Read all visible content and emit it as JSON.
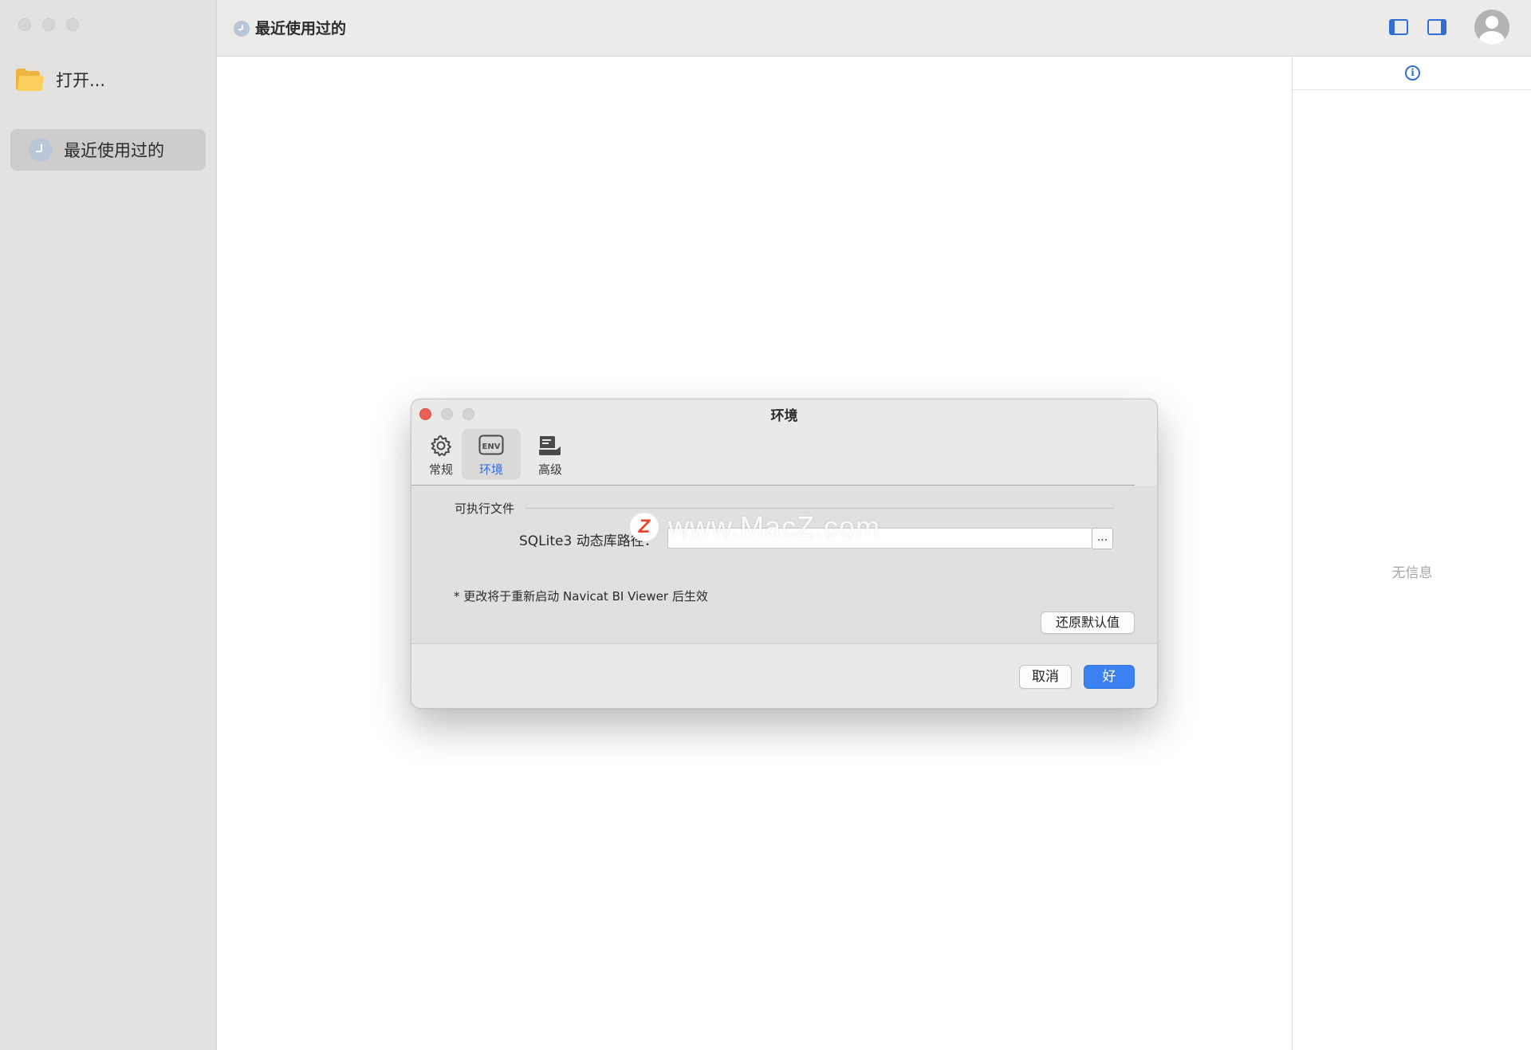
{
  "sidebar": {
    "open_label": "打开...",
    "recent_label": "最近使用过的"
  },
  "toolbar": {
    "title": "最近使用过的"
  },
  "info_panel": {
    "empty_text": "无信息"
  },
  "dialog": {
    "title": "环境",
    "tabs": [
      {
        "label": "常规",
        "icon": "gear-icon",
        "active": false
      },
      {
        "label": "环境",
        "icon": "env-icon",
        "active": true
      },
      {
        "label": "高级",
        "icon": "advanced-icon",
        "active": false
      }
    ],
    "group_label": "可执行文件",
    "sqlite_label": "SQLite3 动态库路径：",
    "sqlite_path_value": "",
    "browse_label": "...",
    "note": "* 更改将于重新启动 Navicat BI Viewer 后生效",
    "restore_label": "还原默认值",
    "cancel_label": "取消",
    "ok_label": "好"
  },
  "watermark": {
    "logo": "Z",
    "text": "www.MacZ.com"
  },
  "colors": {
    "accent": "#2f6fd6",
    "primary_button": "#3b82f0",
    "close_dot": "#ec5f56",
    "folder": "#f0b43c"
  }
}
